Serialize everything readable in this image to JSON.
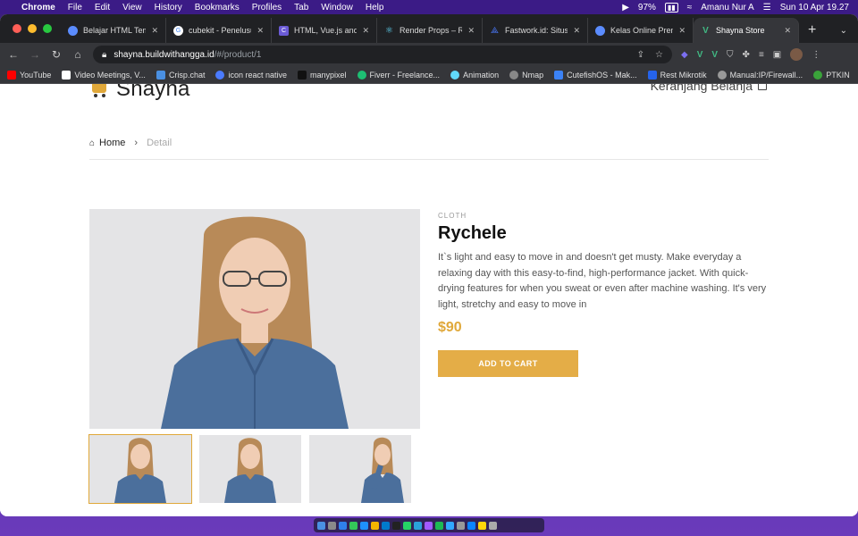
{
  "menubar": {
    "apple": "",
    "app": "Chrome",
    "menus": [
      "File",
      "Edit",
      "View",
      "History",
      "Bookmarks",
      "Profiles",
      "Tab",
      "Window",
      "Help"
    ],
    "battery": "97%",
    "user": "Amanu Nur A",
    "datetime": "Sun 10 Apr  19.27"
  },
  "tabs": [
    {
      "label": "Belajar HTML Temp",
      "icon": "globe-icon",
      "color": "#5b8cff",
      "active": false
    },
    {
      "label": "cubekit - Penelusur",
      "icon": "google-icon",
      "color": "#ffffff",
      "active": false
    },
    {
      "label": "HTML, Vue.js and R",
      "icon": "c-icon",
      "color": "#6b5bd6",
      "active": false
    },
    {
      "label": "Render Props – Rea",
      "icon": "react-icon",
      "color": "#61dafb",
      "active": false
    },
    {
      "label": "Fastwork.id: Situs F",
      "icon": "fastwork-icon",
      "color": "#4b7bff",
      "active": false
    },
    {
      "label": "Kelas Online Premi",
      "icon": "bwa-icon",
      "color": "#5b8cff",
      "active": false
    },
    {
      "label": "Shayna Store",
      "icon": "vue-icon",
      "color": "#41b883",
      "active": true
    }
  ],
  "omnibox": {
    "host": "shayna.buildwithangga.id",
    "path": "/#/product/1"
  },
  "bookmarks": [
    {
      "label": "YouTube",
      "color": "#ff0000"
    },
    {
      "label": "Video Meetings, V...",
      "color": "#ffffff"
    },
    {
      "label": "Crisp.chat",
      "color": "#4a90e2"
    },
    {
      "label": "icon react native",
      "color": "#4a7bff"
    },
    {
      "label": "manypixel",
      "color": "#111111"
    },
    {
      "label": "Fiverr - Freelance...",
      "color": "#1dbf73"
    },
    {
      "label": "Animation",
      "color": "#61dafb"
    },
    {
      "label": "Nmap",
      "color": "#888888"
    },
    {
      "label": "CutefishOS - Mak...",
      "color": "#3b82f6"
    },
    {
      "label": "Rest Mikrotik",
      "color": "#2563eb"
    },
    {
      "label": "Manual:IP/Firewall...",
      "color": "#999999"
    },
    {
      "label": "PTKIN",
      "color": "#3aa33a"
    }
  ],
  "bookmarks_more": "»",
  "site": {
    "brand": "Shayna",
    "cart_link": "Keranjang Belanja"
  },
  "breadcrumb": {
    "home": "Home",
    "current": "Detail"
  },
  "product": {
    "category": "CLOTH",
    "name": "Rychele",
    "description": "It`s light and easy to move in and doesn't get musty. Make everyday a relaxing day with this easy-to-find, high-performance jacket. With quick-drying features for when you sweat or even after machine washing. It's very light, stretchy and easy to move in",
    "price": "$90",
    "add_to_cart": "ADD TO CART"
  },
  "colors": {
    "accent": "#e4ad47",
    "denim": "#4b6f9c",
    "hair": "#b88a58",
    "skin": "#f0cdb4"
  }
}
